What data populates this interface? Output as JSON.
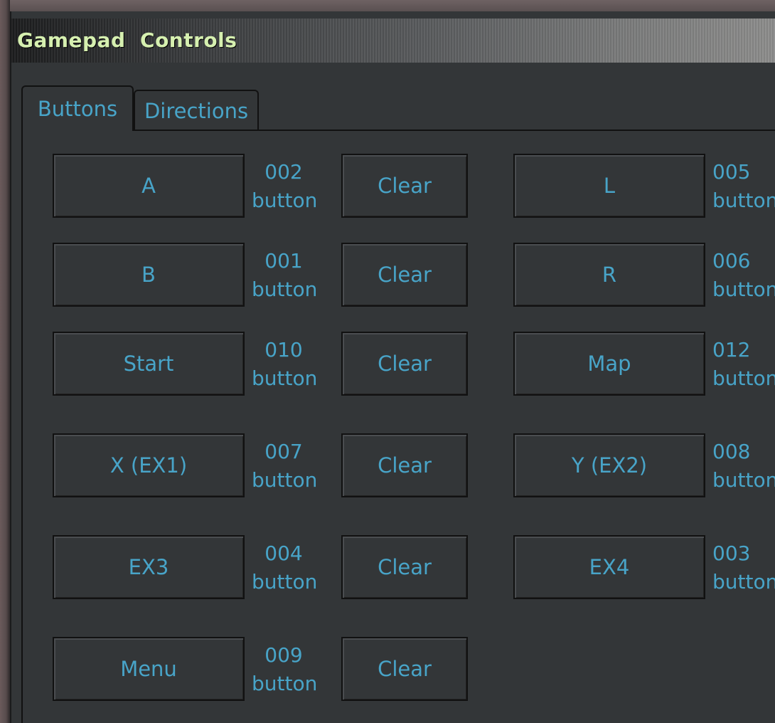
{
  "window": {
    "title": "Gamepad  Controls"
  },
  "tabs": [
    {
      "label": "Buttons",
      "active": true
    },
    {
      "label": "Directions",
      "active": false
    }
  ],
  "colors": {
    "text_accent": "#48a4c8",
    "title_text": "#d6f0b0",
    "panel_bg": "#333638"
  },
  "left_column": [
    {
      "label": "A",
      "code": "002",
      "type": "button",
      "clear": "Clear"
    },
    {
      "label": "B",
      "code": "001",
      "type": "button",
      "clear": "Clear"
    },
    {
      "label": "Start",
      "code": "010",
      "type": "button",
      "clear": "Clear"
    },
    {
      "label": "X  (EX1)",
      "code": "007",
      "type": "button",
      "clear": "Clear"
    },
    {
      "label": "EX3",
      "code": "004",
      "type": "button",
      "clear": "Clear"
    },
    {
      "label": "Menu",
      "code": "009",
      "type": "button",
      "clear": "Clear"
    }
  ],
  "right_column": [
    {
      "label": "L",
      "code": "005",
      "type": "button"
    },
    {
      "label": "R",
      "code": "006",
      "type": "button"
    },
    {
      "label": "Map",
      "code": "012",
      "type": "button"
    },
    {
      "label": "Y  (EX2)",
      "code": "008",
      "type": "button"
    },
    {
      "label": "EX4",
      "code": "003",
      "type": "button"
    }
  ]
}
